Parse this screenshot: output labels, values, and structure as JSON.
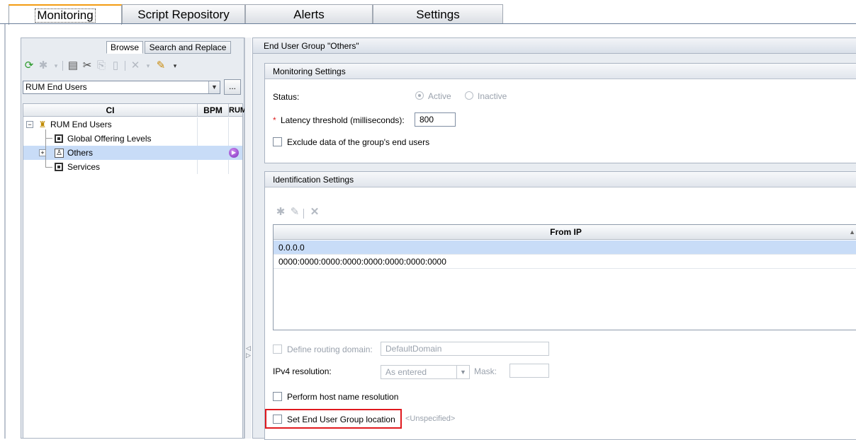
{
  "top_tabs": [
    {
      "label": "Monitoring",
      "active": true
    },
    {
      "label": "Script Repository",
      "active": false
    },
    {
      "label": "Alerts",
      "active": false
    },
    {
      "label": "Settings",
      "active": false
    }
  ],
  "left_panel": {
    "tabs": [
      "Browse",
      "Search and Replace"
    ],
    "toolbar_icons": [
      "refresh-icon",
      "new-icon",
      "properties-icon",
      "cut-icon",
      "copy-icon",
      "paste-icon",
      "delete-icon",
      "edit-icon"
    ],
    "view_selector": {
      "value": "RUM End Users",
      "browse_button": "..."
    },
    "tree": {
      "columns": [
        "CI",
        "BPM",
        "RUM"
      ],
      "rows": [
        {
          "label": "RUM End Users",
          "icon": "rum-end-users-icon"
        },
        {
          "label": "Global Offering Levels",
          "icon": "ci-box-icon"
        },
        {
          "label": "Others",
          "icon": "end-user-group-icon",
          "rum_icon": "rum-monitor-icon"
        },
        {
          "label": "Services",
          "icon": "ci-box-icon"
        }
      ]
    }
  },
  "right_panel": {
    "header": "End User Group \"Others\"",
    "monitoring_settings": {
      "title": "Monitoring Settings",
      "status_label": "Status:",
      "status_options": [
        {
          "label": "Active",
          "selected": true
        },
        {
          "label": "Inactive",
          "selected": false
        }
      ],
      "required_marker": "*",
      "latency_label": "Latency threshold (milliseconds):",
      "latency_value": "800",
      "exclude_label": "Exclude data of the group's end users",
      "exclude_checked": false
    },
    "identification_settings": {
      "title": "Identification Settings",
      "toolbar_icons": [
        "new-icon",
        "edit-icon",
        "delete-icon"
      ],
      "table": {
        "column": "From IP",
        "rows": [
          "0.0.0.0",
          "0000:0000:0000:0000:0000:0000:0000:0000"
        ]
      },
      "routing_label": "Define routing domain:",
      "routing_value": "DefaultDomain",
      "ipv4_label": "IPv4 resolution:",
      "ipv4_value": "As entered",
      "mask_label": "Mask:",
      "mask_value": "",
      "host_resolution_label": "Perform host name resolution",
      "location_label": "Set End User Group location",
      "location_value": "<Unspecified>"
    }
  },
  "colors": {
    "active_tab_accent": "#f39c12",
    "selection": "#c8dcf7",
    "highlight_box": "#e0191e",
    "required": "#dd2222"
  }
}
